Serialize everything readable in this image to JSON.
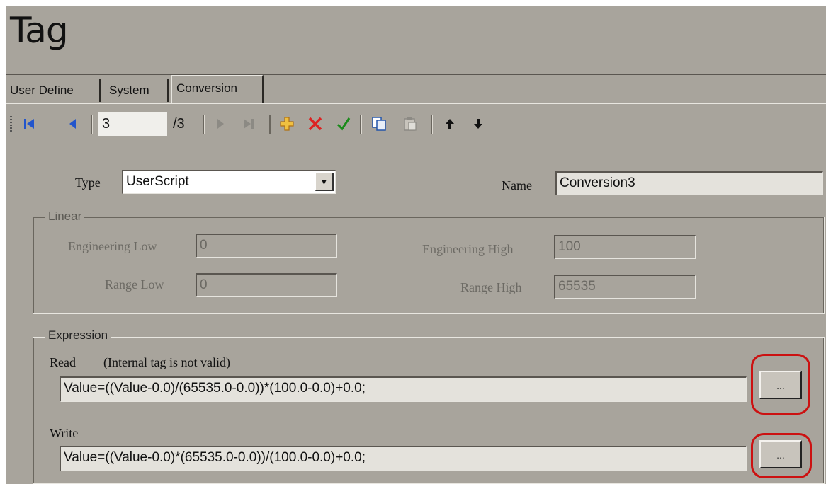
{
  "window": {
    "title": "Tag"
  },
  "tabs": [
    "User Define",
    "System",
    "Conversion"
  ],
  "toolbar": {
    "current_record": "3",
    "total_records": "/3",
    "icons": [
      "first-record-icon",
      "prev-record-icon",
      "next-record-icon",
      "last-record-icon",
      "add-icon",
      "delete-icon",
      "confirm-icon",
      "copy-icon",
      "paste-icon",
      "move-up-icon",
      "move-down-icon"
    ]
  },
  "form": {
    "type_label": "Type",
    "type_value": "UserScript",
    "name_label": "Name",
    "name_value": "Conversion3"
  },
  "linear": {
    "title": "Linear",
    "eng_low_label": "Engineering Low",
    "eng_low_value": "0",
    "eng_high_label": "Engineering High",
    "eng_high_value": "100",
    "range_low_label": "Range Low",
    "range_low_value": "0",
    "range_high_label": "Range High",
    "range_high_value": "65535"
  },
  "expression": {
    "title": "Expression",
    "read_label": "Read",
    "read_note": "(Internal tag is not valid)",
    "read_value": "Value=((Value-0.0)/(65535.0-0.0))*(100.0-0.0)+0.0;",
    "write_label": "Write",
    "write_value": "Value=((Value-0.0)*(65535.0-0.0))/(100.0-0.0)+0.0;",
    "browse_label": "..."
  },
  "colors": {
    "background": "#a8a49c",
    "highlight": "#cc1111",
    "add": "#e0a020",
    "delete": "#dd2222",
    "confirm": "#1a8a1a",
    "nav": "#2255cc"
  }
}
